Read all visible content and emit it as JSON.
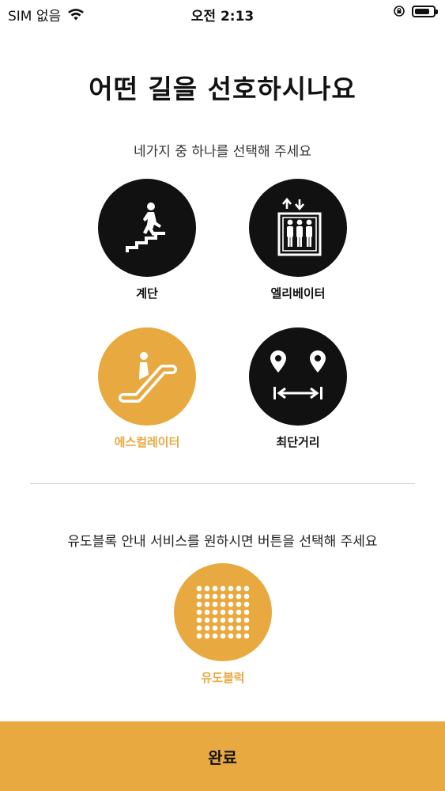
{
  "status_bar": {
    "carrier": "SIM 없음",
    "time": "오전 2:13"
  },
  "title": "어떤 길을 선호하시나요",
  "subtitle": "네가지 중 하나를 선택해 주세요",
  "options": [
    {
      "label": "계단",
      "icon": "stairs-icon",
      "selected": false
    },
    {
      "label": "엘리베이터",
      "icon": "elevator-icon",
      "selected": false
    },
    {
      "label": "에스컬레이터",
      "icon": "escalator-icon",
      "selected": true
    },
    {
      "label": "최단거리",
      "icon": "shortest-route-icon",
      "selected": false
    }
  ],
  "guide": {
    "text": "유도블록 안내 서비스를 원하시면 버튼을 선택해 주세요",
    "button_label": "유도블럭",
    "selected": true
  },
  "done_button": "완료",
  "colors": {
    "accent": "#e9a941",
    "dark": "#111111"
  }
}
